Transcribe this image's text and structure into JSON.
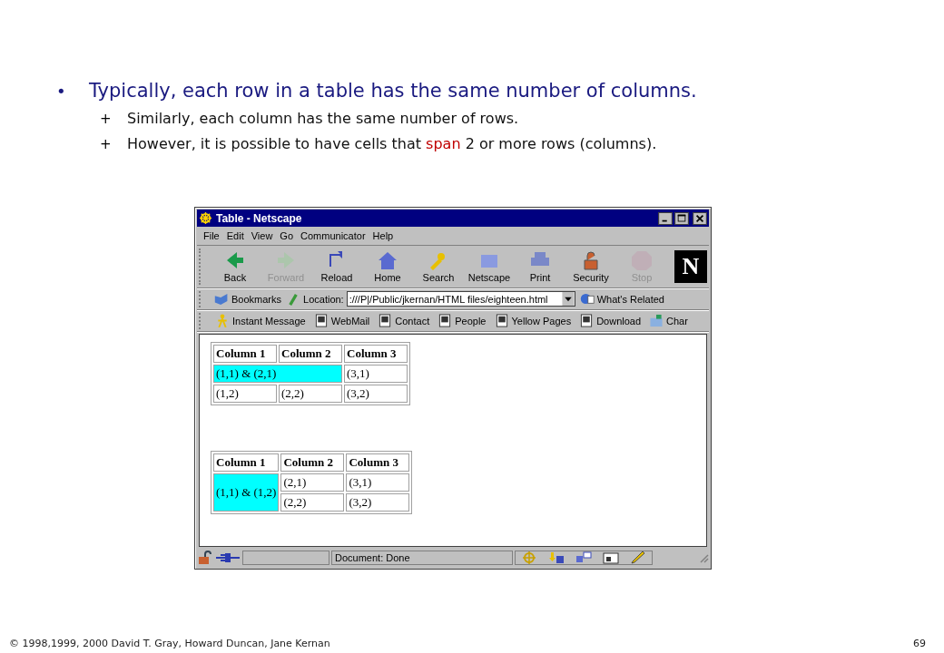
{
  "slide": {
    "bullet": "•",
    "heading": "Typically, each row in a table has the same number of columns.",
    "points": [
      {
        "marker": "+",
        "parts": [
          {
            "text": "Similarly, each column has the same number of rows.",
            "highlight": false
          }
        ]
      },
      {
        "marker": "+",
        "parts": [
          {
            "text": "However, it is possible to have cells that ",
            "highlight": false
          },
          {
            "text": "span",
            "highlight": true
          },
          {
            "text": " 2 or more rows (columns).",
            "highlight": false
          }
        ]
      }
    ]
  },
  "window": {
    "title": "Table - Netscape",
    "menu": [
      "File",
      "Edit",
      "View",
      "Go",
      "Communicator",
      "Help"
    ],
    "toolbar": [
      {
        "label": "Back",
        "disabled": false
      },
      {
        "label": "Forward",
        "disabled": true
      },
      {
        "label": "Reload",
        "disabled": false
      },
      {
        "label": "Home",
        "disabled": false
      },
      {
        "label": "Search",
        "disabled": false
      },
      {
        "label": "Netscape",
        "disabled": false
      },
      {
        "label": "Print",
        "disabled": false
      },
      {
        "label": "Security",
        "disabled": false
      },
      {
        "label": "Stop",
        "disabled": true
      }
    ],
    "logo": "N",
    "bookmarks": "Bookmarks",
    "location_label": "Location:",
    "location": ":///P|/Public/jkernan/HTML files/eighteen.html",
    "related": "What's Related",
    "personal": [
      "Instant Message",
      "WebMail",
      "Contact",
      "People",
      "Yellow Pages",
      "Download",
      "Char"
    ],
    "tables": [
      {
        "columns": [
          "Column 1",
          "Column 2",
          "Column 3"
        ],
        "rows": [
          [
            {
              "text": "(1,1) & (2,1)",
              "colspan": 2,
              "color": "#00ffff"
            },
            {
              "text": "(3,1)"
            }
          ],
          [
            {
              "text": "(1,2)"
            },
            {
              "text": "(2,2)"
            },
            {
              "text": "(3,2)"
            }
          ]
        ]
      },
      {
        "columns": [
          "Column 1",
          "Column 2",
          "Column 3"
        ],
        "rows": [
          [
            {
              "text": "(1,1) & (1,2)",
              "rowspan": 2,
              "color": "#00ffff"
            },
            {
              "text": "(2,1)"
            },
            {
              "text": "(3,1)"
            }
          ],
          [
            {
              "text": "(2,2)"
            },
            {
              "text": "(3,2)"
            }
          ]
        ]
      }
    ],
    "status": "Document: Done"
  },
  "footer": {
    "copyright": "© 1998,1999, 2000 David T. Gray, Howard Duncan, Jane Kernan",
    "page": "69"
  }
}
